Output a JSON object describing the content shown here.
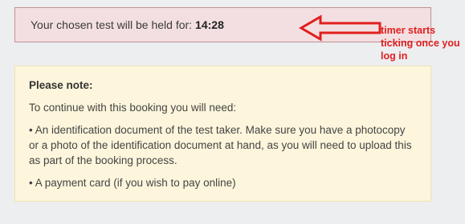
{
  "timer": {
    "label": "Your chosen test will be held for:",
    "value": "14:28"
  },
  "annotation": {
    "text": "timer starts\nticking once you\nlog in",
    "color": "#e02020"
  },
  "note": {
    "title": "Please note:",
    "intro": "To continue with this booking you will need:",
    "items": [
      "• An identification document of the test taker. Make sure you have a photocopy or a photo of the identification document at hand, as you will need to upload this as part of the booking process.",
      "• A payment card (if you wish to pay online)"
    ]
  },
  "colors": {
    "timer_bg": "#f3dfe1",
    "timer_border": "#c48f95",
    "note_bg": "#fdf6dc",
    "note_border": "#f0e2b0",
    "arrow": "#e02020"
  }
}
